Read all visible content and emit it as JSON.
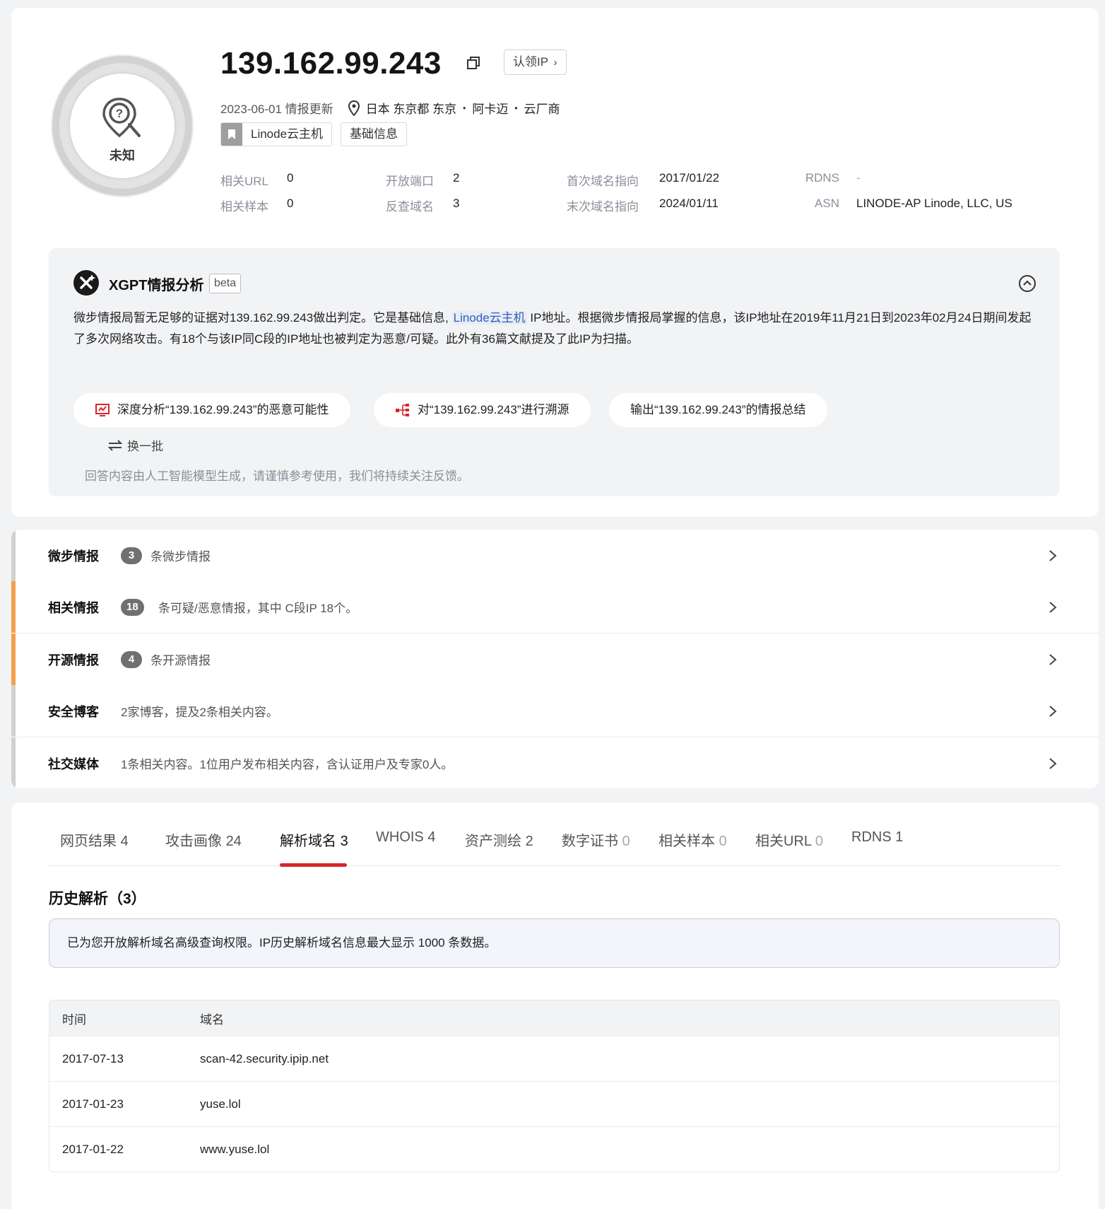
{
  "verdict": {
    "label": "未知",
    "ring_color": "#d2d2d2"
  },
  "header": {
    "ip": "139.162.99.243",
    "claim_button": "认领IP",
    "updated": "2023-06-01 情报更新",
    "location": "日本 东京都 东京",
    "location_sep1": "•",
    "org": "阿卡迈",
    "location_sep2": "•",
    "type": "云厂商",
    "tags": [
      "Linode云主机",
      "基础信息"
    ]
  },
  "stats": {
    "related_url": {
      "label": "相关URL",
      "value": "0"
    },
    "related_sample": {
      "label": "相关样本",
      "value": "0"
    },
    "open_ports": {
      "label": "开放端口",
      "value": "2"
    },
    "reverse_domains": {
      "label": "反查域名",
      "value": "3"
    },
    "first_domain": {
      "label": "首次域名指向",
      "value": "2017/01/22"
    },
    "last_domain": {
      "label": "末次域名指向",
      "value": "2024/01/11"
    },
    "rdns": {
      "label": "RDNS",
      "value": "-"
    },
    "asn": {
      "label": "ASN",
      "value": "LINODE-AP Linode, LLC, US"
    }
  },
  "xgpt": {
    "title": "XGPT情报分析",
    "badge": "beta",
    "text_part1": "微步情报局暂无足够的证据对139.162.99.243做出判定。它是基础信息, ",
    "text_highlight": "Linode云主机",
    "text_part2": " IP地址。根据微步情报局掌握的信息，该IP地址在2019年11月21日到2023年02月24日期间发起了多次网络攻击。有18个与该IP同C段的IP地址也被判定为恶意/可疑。此外有36篇文献提及了此IP为扫描。",
    "prompts": [
      "深度分析“139.162.99.243”的恶意可能性",
      "对“139.162.99.243”进行溯源",
      "输出“139.162.99.243”的情报总结"
    ],
    "refresh": "换一批",
    "disclaimer": "回答内容由人工智能模型生成，请谨慎参考使用，我们将持续关注反馈。"
  },
  "intel": [
    {
      "title": "微步情报",
      "count": "3",
      "desc": "条微步情报",
      "bar_color": "#d0d0d0"
    },
    {
      "title": "相关情报",
      "count": "18",
      "desc": "条可疑/恶意情报，其中 C段IP 18个。",
      "bar_color": "#f5a04a"
    },
    {
      "title": "开源情报",
      "count": "4",
      "desc": "条开源情报",
      "bar_color": "#f5a04a"
    },
    {
      "title": "安全博客",
      "count": "",
      "desc": "2家博客，提及2条相关内容。",
      "bar_color": "#d0d0d0"
    },
    {
      "title": "社交媒体",
      "count": "",
      "desc": "1条相关内容。1位用户发布相关内容，含认证用户及专家0人。",
      "bar_color": "#d0d0d0"
    }
  ],
  "tabs": [
    {
      "label": "网页结果",
      "count": "4"
    },
    {
      "label": "攻击画像",
      "count": "24"
    },
    {
      "label": "解析域名",
      "count": "3",
      "active": true
    },
    {
      "label": "WHOIS",
      "count": "4"
    },
    {
      "label": "资产测绘",
      "count": "2"
    },
    {
      "label": "数字证书",
      "count": "0"
    },
    {
      "label": "相关样本",
      "count": "0"
    },
    {
      "label": "相关URL",
      "count": "0"
    },
    {
      "label": "RDNS",
      "count": "1"
    }
  ],
  "history": {
    "title": "历史解析（3）",
    "notice": "已为您开放解析域名高级查询权限。IP历史解析域名信息最大显示 1000 条数据。",
    "columns": [
      "时间",
      "域名"
    ],
    "rows": [
      [
        "2017-07-13",
        "scan-42.security.ipip.net"
      ],
      [
        "2017-01-23",
        "yuse.lol"
      ],
      [
        "2017-01-22",
        "www.yuse.lol"
      ]
    ]
  },
  "colors": {
    "accent": "#d7262b",
    "highlight_link": "#2e5fb8",
    "warning_bar": "#f5a04a"
  }
}
